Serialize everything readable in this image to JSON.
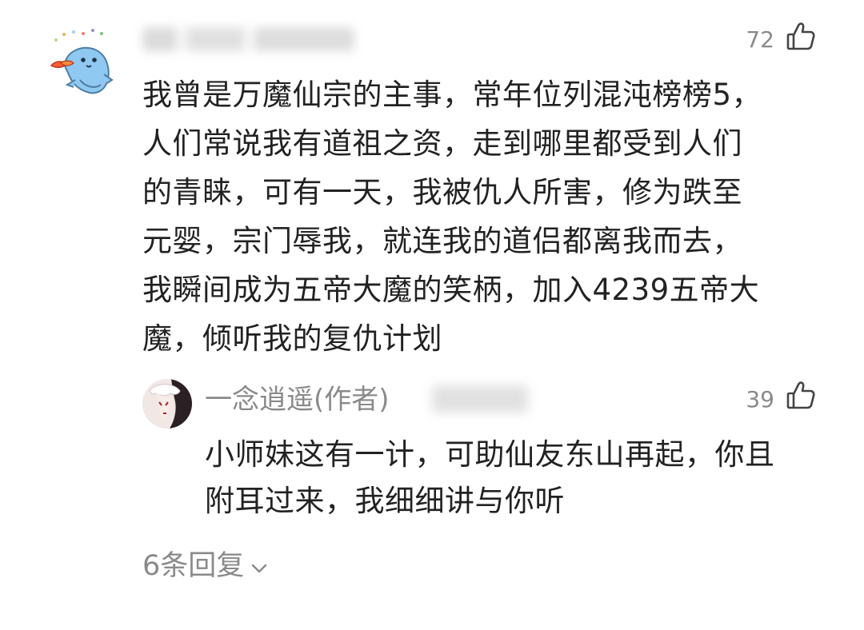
{
  "comment": {
    "likes": "72",
    "text_lines": [
      "我曾是万魔仙宗的主事，常年位列混沌榜榜5，",
      "人们常说我有道祖之资，走到哪里都受到人们",
      "的青睐，可有一天，我被仇人所害，修为跌至",
      "元婴，宗门辱我，就连我的道侣都离我而去，",
      "我瞬间成为五帝大魔的笑柄，加入4239五帝大",
      "魔，倾听我的复仇计划"
    ]
  },
  "reply": {
    "author": "一念逍遥(作者)",
    "likes": "39",
    "text_lines": [
      "小师妹这有一计，可助仙友东山再起，你且",
      "附耳过来，我细细讲与你听"
    ]
  },
  "more_replies": {
    "label": "6条回复"
  },
  "icons": {
    "like": "thumbs-up-icon",
    "expand": "chevron-down-icon"
  },
  "colors": {
    "text_primary": "#222222",
    "text_secondary": "#8a8a8a",
    "background": "#ffffff"
  }
}
